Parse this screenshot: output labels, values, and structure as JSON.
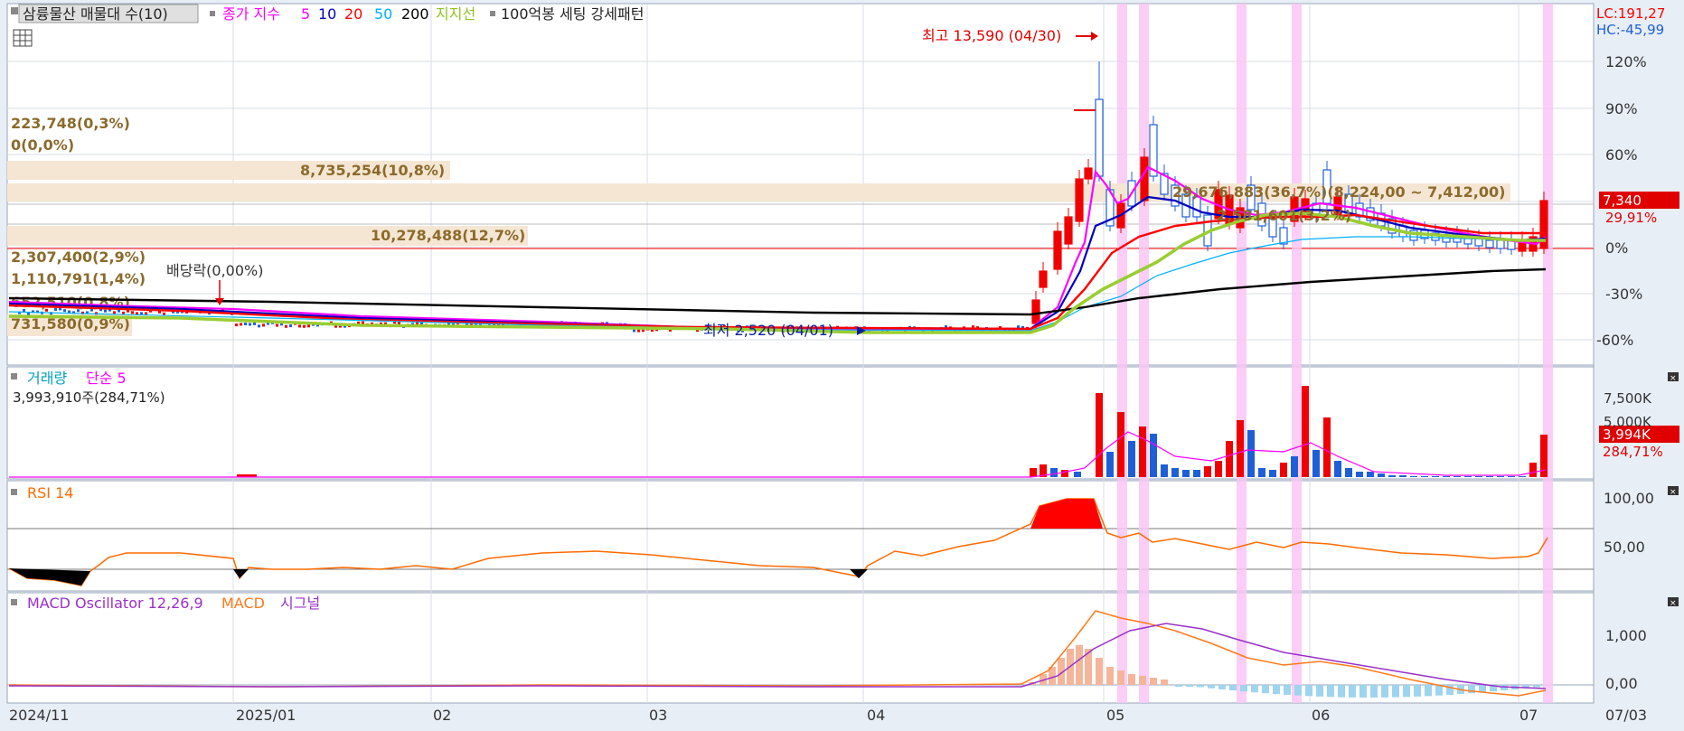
{
  "colors": {
    "frame_bg": "#e8eef6",
    "grid": "#d7dce4",
    "up": "#f00000",
    "down": "#1e5fd8",
    "zero_line": "#ff0000",
    "pink_band": "#f9c6f5",
    "vol_profile": "#f5e6d3",
    "vol_profile_text": "#8b6a2c",
    "ma5": "#ff00ff",
    "ma10": "#0000c0",
    "ma20": "#ff0000",
    "ma50": "#00b0ff",
    "ma200": "#000000",
    "support": "#9acd32",
    "rsi": "#ff6a00",
    "macd": "#ff7a1a",
    "signal": "#9b30c8",
    "osc_pos": "#f4b59b",
    "osc_neg": "#9ed4ee"
  },
  "legend": {
    "main": {
      "title": "삼륭물산 매물대 수(10)",
      "ma_label": "종가 지수",
      "ma5": "5",
      "ma10": "10",
      "ma20": "20",
      "ma50": "50",
      "ma200": "200",
      "support": "지지선",
      "pattern": "100억봉 세팅 강세패턴"
    },
    "volume": {
      "name": "거래량",
      "avg": "단순 5",
      "value": "3,993,910주(284,71%)"
    },
    "rsi": {
      "name": "RSI 14"
    },
    "macd": {
      "name": "MACD Oscillator 12,26,9",
      "macd": "MACD",
      "signal": "시그널"
    }
  },
  "corner": {
    "lc": "LC:191,27",
    "hc": "HC:-45,99"
  },
  "annotations": {
    "high": "최고 13,590 (04/30)",
    "low": "최저 2,520 (04/01)",
    "dividend": "배당락(0,00%)",
    "price_tag": "7,340",
    "pct_tag": "29,91%",
    "vol_tag": "3,994K",
    "vol_pct_tag": "284,71%",
    "overlay_text_1": "29,676,883(36,7%)(8,224,00 ~ 7,412,00)",
    "overlay_text_2": "2,581,601(3,2%)"
  },
  "volume_profile": [
    {
      "label": "223,748(0,3%)"
    },
    {
      "label": "0(0,0%)"
    },
    {
      "label": "8,735,254(10,8%)"
    },
    {
      "label": "10,278,488(12,7%)"
    },
    {
      "label": "2,307,400(2,9%)"
    },
    {
      "label": "1,110,791(1,4%)"
    },
    {
      "label": "652,510(0,8%)"
    },
    {
      "label": "731,580(0,9%)"
    }
  ],
  "x_axis": [
    "2024/11",
    "2025/01",
    "02",
    "03",
    "04",
    "05",
    "06",
    "07",
    "07/03"
  ],
  "chart_data": {
    "type": "candlestick",
    "y_axis_labels": [
      "120%",
      "90%",
      "60%",
      "30%",
      "0%",
      "-30%",
      "-60%"
    ],
    "volume_axis_labels": [
      "7,500K",
      "5,000K"
    ],
    "rsi_axis_labels": [
      "100,00",
      "50,00"
    ],
    "macd_axis_labels": [
      "1,000",
      "0,00"
    ],
    "high": {
      "value": 13590,
      "date": "04/30"
    },
    "low": {
      "value": 2520,
      "date": "04/01"
    },
    "last_close": 7340
  }
}
